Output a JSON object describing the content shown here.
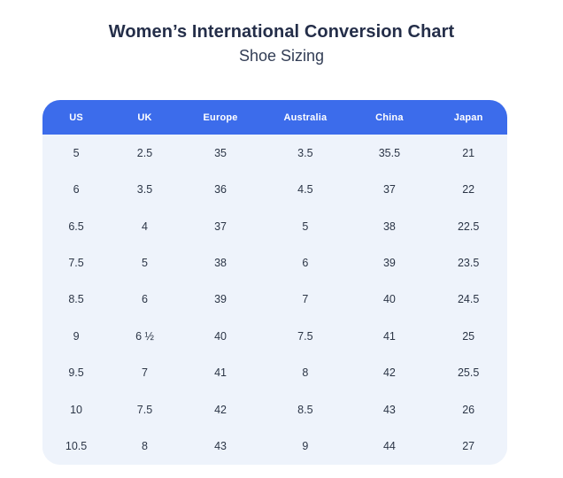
{
  "chart_data": {
    "type": "table",
    "title": "Women’s International Conversion Chart",
    "subtitle": "Shoe Sizing",
    "columns": [
      "US",
      "UK",
      "Europe",
      "Australia",
      "China",
      "Japan"
    ],
    "rows": [
      [
        "5",
        "2.5",
        "35",
        "3.5",
        "35.5",
        "21"
      ],
      [
        "6",
        "3.5",
        "36",
        "4.5",
        "37",
        "22"
      ],
      [
        "6.5",
        "4",
        "37",
        "5",
        "38",
        "22.5"
      ],
      [
        "7.5",
        "5",
        "38",
        "6",
        "39",
        "23.5"
      ],
      [
        "8.5",
        "6",
        "39",
        "7",
        "40",
        "24.5"
      ],
      [
        "9",
        "6 ½",
        "40",
        "7.5",
        "41",
        "25"
      ],
      [
        "9.5",
        "7",
        "41",
        "8",
        "42",
        "25.5"
      ],
      [
        "10",
        "7.5",
        "42",
        "8.5",
        "43",
        "26"
      ],
      [
        "10.5",
        "8",
        "43",
        "9",
        "44",
        "27"
      ]
    ]
  },
  "colors": {
    "header_bg": "#3c6ceb",
    "header_text": "#ffffff",
    "body_bg": "#eef3fb",
    "title_text": "#242e49",
    "cell_text": "#2b3546",
    "page_bg": "#ffffff"
  }
}
